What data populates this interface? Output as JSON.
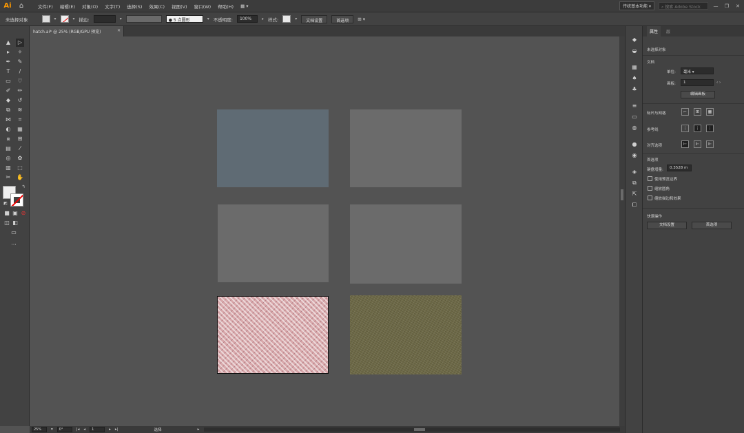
{
  "app": {
    "logo": "Ai",
    "home_icon": "home-icon"
  },
  "menu": [
    "文件(F)",
    "编辑(E)",
    "对象(O)",
    "文字(T)",
    "选择(S)",
    "效果(C)",
    "视图(V)",
    "窗口(W)",
    "帮助(H)"
  ],
  "workspace_switch": "▦ ▾",
  "workspace": "传统基本功能",
  "search_placeholder": "搜索 Adobe Stock",
  "window_controls": {
    "minimize": "—",
    "restore": "❐",
    "close": "✕"
  },
  "control_bar": {
    "selection_label": "未选择对象",
    "stroke_label": "描边:",
    "stroke_value": "",
    "point_label": "5 点圆形",
    "opacity_label": "不透明度:",
    "opacity_value": "100%",
    "style_label": "样式:",
    "doc_setup_button": "文档设置",
    "preferences_button": "首选项"
  },
  "document_tab": {
    "title": "hatch.ai* @ 25% (RGB/GPU 预览)",
    "close": "✕"
  },
  "toolbar_more": "···",
  "status_bar": {
    "zoom": "25%",
    "angle": "0°",
    "artboard": "1",
    "info": "选择"
  },
  "properties": {
    "tab_active": "属性",
    "tab_inactive": "层",
    "no_selection": "未选择对象",
    "document_heading": "文档",
    "units_label": "单位:",
    "units_value": "毫米",
    "artboard_label": "画板:",
    "artboard_value": "1",
    "edit_artboards_button": "编辑画板",
    "ruler_grid_label": "标尺与网格",
    "guides_label": "参考线",
    "align_label": "对齐选项",
    "preferences_heading": "首选项",
    "keyboard_increment_label": "键盘增量:",
    "keyboard_increment_value": "0.3528 m",
    "checkbox_1": "使用预览边界",
    "checkbox_2": "缩放圆角",
    "checkbox_3": "缩放描边和效果",
    "quick_actions_heading": "快速操作",
    "doc_setup_button": "文档设置",
    "preferences_button": "首选项"
  },
  "artboards": [
    {
      "name": "slate-blue-artboard",
      "color": "#5f6b74",
      "pattern": "none"
    },
    {
      "name": "grey-artboard-1",
      "color": "#6b6b6b",
      "pattern": "none"
    },
    {
      "name": "grey-artboard-2",
      "color": "#6b6b6b",
      "pattern": "none"
    },
    {
      "name": "grey-artboard-3",
      "color": "#6b6b6b",
      "pattern": "none"
    },
    {
      "name": "pink-pattern-artboard",
      "color": "#d8a8ab",
      "pattern": "hatch"
    },
    {
      "name": "olive-texture-artboard",
      "color": "#6e6a48",
      "pattern": "noise"
    }
  ],
  "tool_icons": [
    "selection-icon",
    "direct-selection-icon",
    "pen-icon",
    "type-icon",
    "rectangle-icon",
    "paintbrush-icon",
    "eraser-icon",
    "rotate-icon",
    "scale-icon",
    "width-icon",
    "shape-builder-icon",
    "gradient-icon",
    "eyedropper-icon",
    "blend-icon",
    "symbol-sprayer-icon",
    "graph-icon",
    "artboard-icon",
    "slice-icon",
    "hand-icon",
    "zoom-icon"
  ]
}
